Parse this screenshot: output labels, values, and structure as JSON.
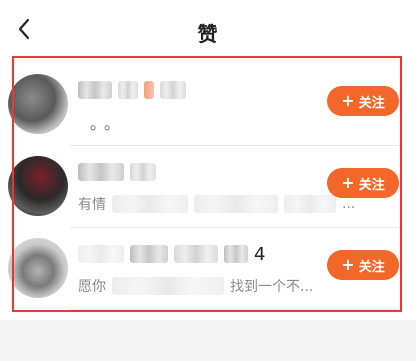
{
  "header": {
    "title": "赞",
    "back_icon": "chevron-left-icon"
  },
  "colors": {
    "accent": "#f4672a",
    "highlight_border": "#e53935"
  },
  "likes": [
    {
      "name_suffix": "",
      "snippet_prefix": "",
      "snippet_suffix": "。。",
      "follow_label": "关注",
      "follow_icon": "plus-icon"
    },
    {
      "name_suffix": "",
      "snippet_prefix": "有情",
      "snippet_suffix": "...",
      "follow_label": "关注",
      "follow_icon": "plus-icon"
    },
    {
      "name_suffix": "4",
      "snippet_prefix": "愿你",
      "snippet_suffix": "找到一个不...",
      "follow_label": "关注",
      "follow_icon": "plus-icon"
    }
  ]
}
